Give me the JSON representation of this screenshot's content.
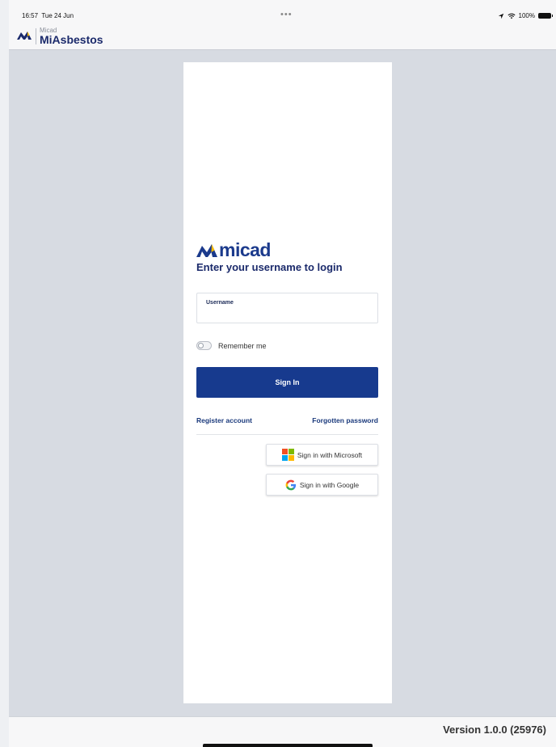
{
  "status_bar": {
    "time": "16:57",
    "date": "Tue 24 Jun",
    "dots": "•••",
    "battery": "100%"
  },
  "header": {
    "subtitle": "Micad",
    "title": "MiAsbestos"
  },
  "login": {
    "brand": "micad",
    "heading": "Enter your username to login",
    "username_label": "Username",
    "username_value": "",
    "remember_label": "Remember me",
    "remember_on": false,
    "sign_in_label": "Sign In",
    "register_label": "Register account",
    "forgot_label": "Forgotten password",
    "microsoft_label": "Sign in with Microsoft",
    "google_label": "Sign in with Google"
  },
  "footer": {
    "version": "Version 1.0.0 (25976)"
  },
  "colors": {
    "primary": "#173a8e",
    "background": "#d7dbe2",
    "card": "#ffffff",
    "brand_dark": "#1b2a6b",
    "brand_yellow": "#f2b705"
  },
  "icons": {
    "location": "location-arrow-icon",
    "wifi": "wifi-icon",
    "battery": "battery-icon",
    "microsoft": "microsoft-logo-icon",
    "google": "google-logo-icon"
  }
}
